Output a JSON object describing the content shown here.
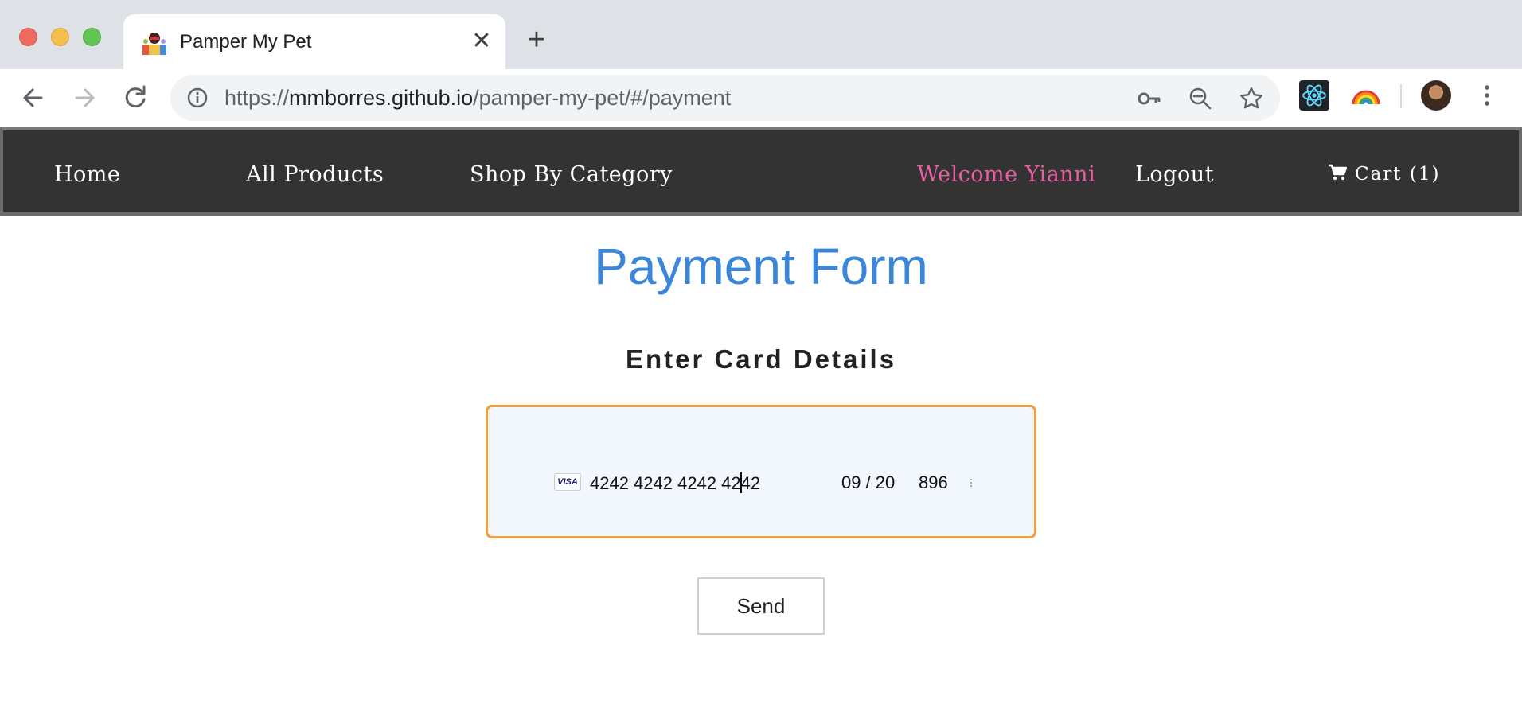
{
  "browser": {
    "tab": {
      "title": "Pamper My Pet",
      "favicon": "pet-favicon-icon",
      "close_label": "✕"
    },
    "new_tab_label": "+",
    "url": {
      "scheme": "https://",
      "host": "mmborres.github.io",
      "path": "/pamper-my-pet/#/payment"
    },
    "icons": [
      "back-icon",
      "forward-icon",
      "reload-icon",
      "info-icon",
      "key-icon",
      "zoom-out-icon",
      "star-icon",
      "react-devtools-icon",
      "rainbow-extension-icon",
      "profile-avatar",
      "menu-icon"
    ]
  },
  "nav": {
    "home": "Home",
    "all_products": "All Products",
    "shop_by_category": "Shop By Category",
    "welcome": "Welcome Yianni",
    "logout": "Logout",
    "cart": "Cart (1)"
  },
  "page": {
    "title": "Payment Form",
    "subtitle": "Enter Card Details"
  },
  "card": {
    "brand": "VISA",
    "number_before_caret": "4242 4242 4242 42",
    "number_after_caret": "42",
    "expiry": "09 / 20",
    "cvc": "896"
  },
  "form": {
    "send_label": "Send"
  },
  "colors": {
    "title_blue": "#3b86d8",
    "welcome_pink": "#ea5fa1",
    "nav_bg": "#333333",
    "card_border": "#f0a03c",
    "card_bg": "#f1f7fd"
  }
}
